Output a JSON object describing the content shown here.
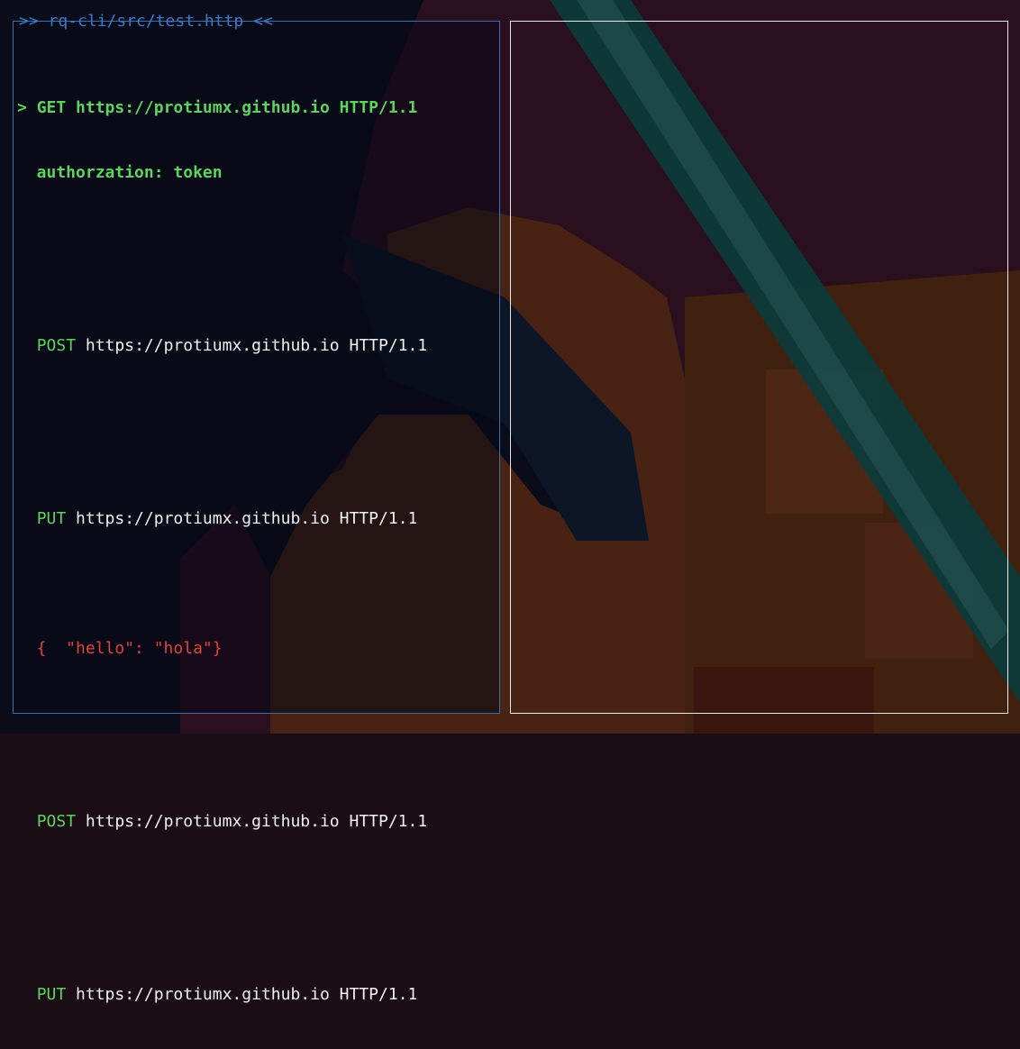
{
  "app": {
    "left_pane_title": ">> rq-cli/src/test.http <<"
  },
  "requests": [
    {
      "cursor": "> ",
      "method": "GET",
      "url": " https://protiumx.github.io HTTP/1.1",
      "selected": true,
      "header": "  authorzation: token"
    },
    {
      "cursor": "  ",
      "method": "POST",
      "url": " https://protiumx.github.io HTTP/1.1"
    },
    {
      "cursor": "  ",
      "method": "PUT",
      "url": " https://protiumx.github.io HTTP/1.1",
      "body": "  {  \"hello\": \"hola\"}"
    },
    {
      "cursor": "  ",
      "method": "POST",
      "url": " https://protiumx.github.io HTTP/1.1"
    },
    {
      "cursor": "  ",
      "method": "PUT",
      "url": " https://protiumx.github.io HTTP/1.1"
    }
  ],
  "colors": {
    "pane_border_active": "#3a6fb0",
    "pane_border_response": "#e8e8e8",
    "method_green": "#5fd35f",
    "body_red": "#e0433a",
    "title_blue": "#3a78c9"
  }
}
